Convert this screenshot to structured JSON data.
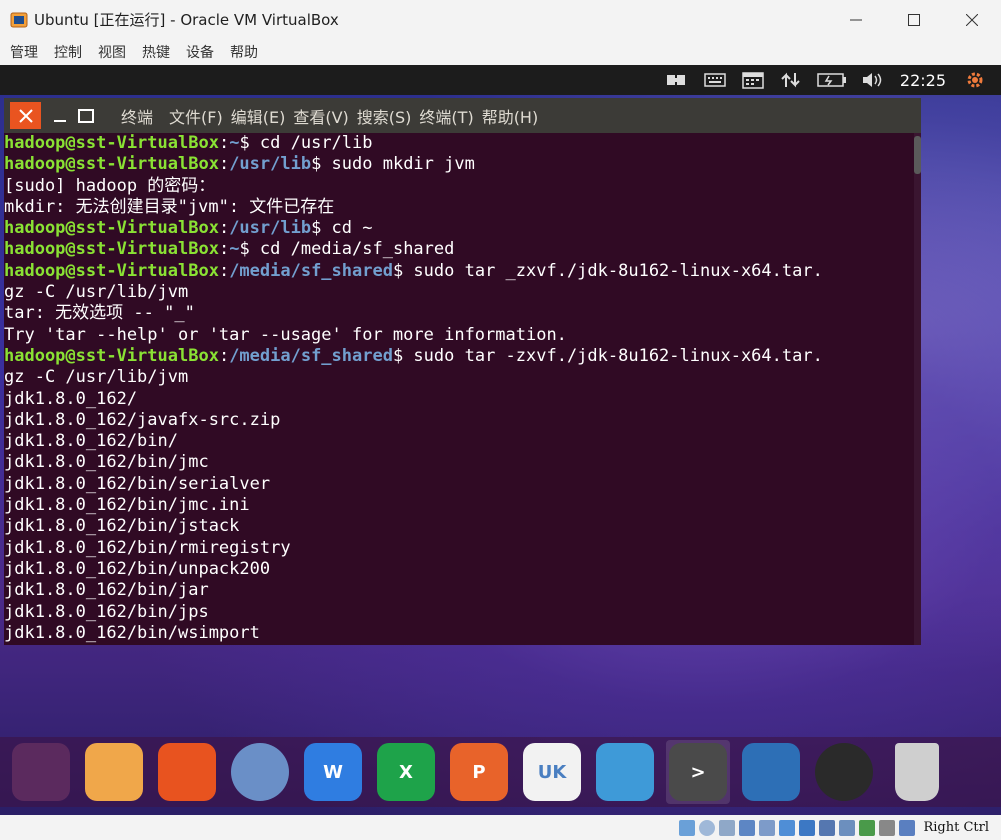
{
  "window": {
    "title": "Ubuntu [正在运行] - Oracle VM VirtualBox"
  },
  "menubar": [
    "管理",
    "控制",
    "视图",
    "热键",
    "设备",
    "帮助"
  ],
  "guest_topbar": {
    "icons": [
      "input-icon",
      "keyboard-icon",
      "calendar-icon",
      "network-icon",
      "battery-icon",
      "volume-icon"
    ],
    "clock": "22:25"
  },
  "terminal": {
    "name": "终端",
    "menus": [
      "文件(F)",
      "编辑(E)",
      "查看(V)",
      "搜索(S)",
      "终端(T)",
      "帮助(H)"
    ],
    "lines": [
      {
        "user": "hadoop@sst-VirtualBox",
        "sep": ":",
        "path": "~",
        "cmd": "$ cd /usr/lib"
      },
      {
        "user": "hadoop@sst-VirtualBox",
        "sep": ":",
        "path": "/usr/lib",
        "cmd": "$ sudo mkdir jvm"
      },
      {
        "text": "[sudo] hadoop 的密码："
      },
      {
        "text": "mkdir: 无法创建目录\"jvm\": 文件已存在"
      },
      {
        "user": "hadoop@sst-VirtualBox",
        "sep": ":",
        "path": "/usr/lib",
        "cmd": "$ cd ~"
      },
      {
        "user": "hadoop@sst-VirtualBox",
        "sep": ":",
        "path": "~",
        "cmd": "$ cd /media/sf_shared"
      },
      {
        "user": "hadoop@sst-VirtualBox",
        "sep": ":",
        "path": "/media/sf_shared",
        "cmd": "$ sudo tar _zxvf./jdk-8u162-linux-x64.tar."
      },
      {
        "text": "gz -C /usr/lib/jvm"
      },
      {
        "text": "tar: 无效选项 -- \"_\""
      },
      {
        "text": "Try 'tar --help' or 'tar --usage' for more information."
      },
      {
        "user": "hadoop@sst-VirtualBox",
        "sep": ":",
        "path": "/media/sf_shared",
        "cmd": "$ sudo tar -zxvf./jdk-8u162-linux-x64.tar."
      },
      {
        "text": "gz -C /usr/lib/jvm"
      },
      {
        "text": "jdk1.8.0_162/"
      },
      {
        "text": "jdk1.8.0_162/javafx-src.zip"
      },
      {
        "text": "jdk1.8.0_162/bin/"
      },
      {
        "text": "jdk1.8.0_162/bin/jmc"
      },
      {
        "text": "jdk1.8.0_162/bin/serialver"
      },
      {
        "text": "jdk1.8.0_162/bin/jmc.ini"
      },
      {
        "text": "jdk1.8.0_162/bin/jstack"
      },
      {
        "text": "jdk1.8.0_162/bin/rmiregistry"
      },
      {
        "text": "jdk1.8.0_162/bin/unpack200"
      },
      {
        "text": "jdk1.8.0_162/bin/jar"
      },
      {
        "text": "jdk1.8.0_162/bin/jps"
      },
      {
        "text": "jdk1.8.0_162/bin/wsimport"
      }
    ]
  },
  "dock": {
    "items": [
      {
        "name": "ubuntu-logo-icon",
        "color": "#5b2a5e"
      },
      {
        "name": "files-icon",
        "color": "#f0a74a"
      },
      {
        "name": "firefox-icon",
        "color": "#e8531f"
      },
      {
        "name": "browser-icon",
        "color": "#6a8fc7"
      },
      {
        "name": "wps-writer-icon",
        "color": "#2f7de1",
        "label": "W"
      },
      {
        "name": "wps-spreadsheet-icon",
        "color": "#1ea34a",
        "label": "X"
      },
      {
        "name": "wps-presentation-icon",
        "color": "#e8632a",
        "label": "P"
      },
      {
        "name": "ubuntu-kylin-store-icon",
        "color": "#f2f2f2",
        "label": "UK"
      },
      {
        "name": "robot-assistant-icon",
        "color": "#3e9ad8"
      },
      {
        "name": "terminal-icon",
        "color": "#4a4a4a",
        "label": ">"
      },
      {
        "name": "workspace-icon",
        "color": "#2d6fb6"
      },
      {
        "name": "dvd-icon",
        "color": "#2a2a2a"
      },
      {
        "name": "trash-icon",
        "color": "#cfcfcf"
      }
    ]
  },
  "statusbar": {
    "host_key": "Right Ctrl"
  },
  "colors": {
    "terminal_bg": "#300a24",
    "prompt_user": "#8ae234",
    "prompt_path": "#729fcf",
    "close_button": "#e95420"
  }
}
